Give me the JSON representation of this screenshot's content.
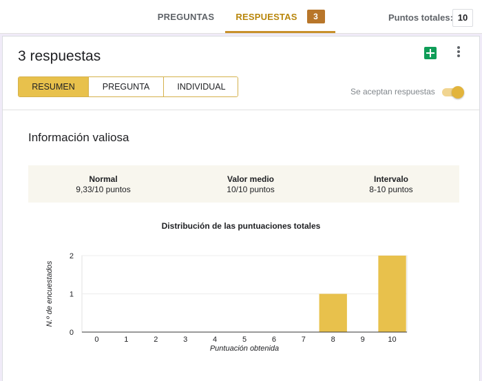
{
  "tabs": {
    "preguntas": "PREGUNTAS",
    "respuestas": "RESPUESTAS",
    "respuestas_count": "3"
  },
  "points": {
    "label": "Puntos totales:",
    "value": "10"
  },
  "summary": {
    "title": "3 respuestas",
    "views": [
      "RESUMEN",
      "PREGUNTA",
      "INDIVIDUAL"
    ],
    "active_view": "RESUMEN",
    "accepting_label": "Se aceptan respuestas",
    "accepting": true
  },
  "insights": {
    "title": "Información valiosa",
    "stats": [
      {
        "label": "Normal",
        "value": "9,33/10 puntos"
      },
      {
        "label": "Valor medio",
        "value": "10/10 puntos"
      },
      {
        "label": "Intervalo",
        "value": "8-10 puntos"
      }
    ]
  },
  "colors": {
    "accent": "#c8902a",
    "bar": "#e8c14c",
    "sheets": "#0f9d58"
  },
  "chart_data": {
    "type": "bar",
    "title": "Distribución de las puntuaciones totales",
    "xlabel": "Puntuación obtenida",
    "ylabel": "N.º de encuestados",
    "categories": [
      "0",
      "1",
      "2",
      "3",
      "4",
      "5",
      "6",
      "7",
      "8",
      "9",
      "10"
    ],
    "values": [
      0,
      0,
      0,
      0,
      0,
      0,
      0,
      0,
      1,
      0,
      2
    ],
    "ylim": [
      0,
      2
    ],
    "yticks": [
      0,
      1,
      2
    ],
    "grid": true
  }
}
